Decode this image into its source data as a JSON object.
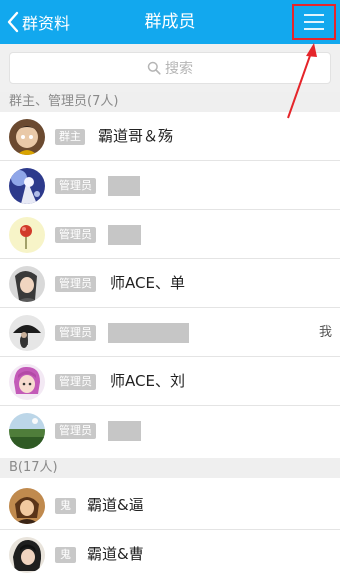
{
  "header": {
    "back_label": "群资料",
    "title": "群成员",
    "menu_icon": "menu-icon",
    "background": "#12a8ee"
  },
  "search": {
    "placeholder": "搜索"
  },
  "sections": [
    {
      "title": "群主、管理员(7人)",
      "members": [
        {
          "role": "群主",
          "name": "霸道哥＆殇",
          "avatar": "avatar-owner"
        },
        {
          "role": "管理员",
          "name": "",
          "redacted": true,
          "avatar": "avatar-anime"
        },
        {
          "role": "管理员",
          "name": "",
          "redacted": true,
          "avatar": "avatar-flower"
        },
        {
          "role": "管理员",
          "name": "师ACE、单",
          "avatar": "avatar-girl"
        },
        {
          "role": "管理员",
          "name": "",
          "redacted": true,
          "self": "我",
          "avatar": "avatar-umbrella"
        },
        {
          "role": "管理员",
          "name": "师ACE、刘",
          "avatar": "avatar-pink-hair"
        },
        {
          "role": "管理员",
          "name": "",
          "redacted": true,
          "avatar": "avatar-landscape"
        }
      ]
    },
    {
      "title": "B(17人)",
      "members": [
        {
          "role": "鬼",
          "name": "霸道&逼",
          "avatar": "avatar-brown"
        },
        {
          "role": "鬼",
          "name": "霸道&曹",
          "avatar": "avatar-dark-hair"
        }
      ]
    }
  ],
  "annotation": {
    "color": "#e5252a"
  }
}
